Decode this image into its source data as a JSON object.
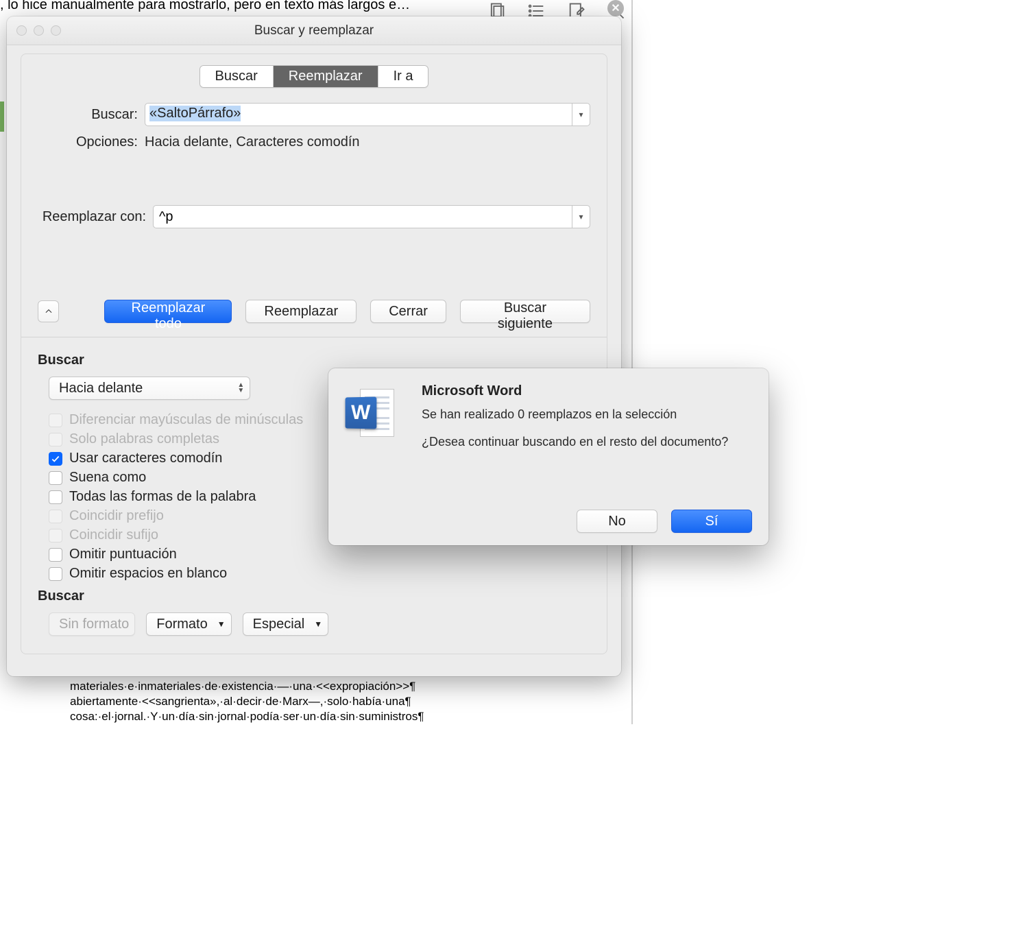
{
  "background": {
    "top_text": ", lo hice manualmente para mostrarlo, pero en texto más largos e…",
    "doc_lines": [
      "materiales·e·inmateriales·de·existencia·—·una·<<expropiación>>¶",
      "abiertamente·<<sangrienta»,·al·decir·de·Marx—,·solo·había·una¶",
      "cosa:·el·jornal.·Y·un·día·sin·jornal·podía·ser·un·día·sin·suministros¶"
    ]
  },
  "window": {
    "title": "Buscar y reemplazar",
    "tabs": {
      "search": "Buscar",
      "replace": "Reemplazar",
      "goto": "Ir a"
    },
    "labels": {
      "find": "Buscar:",
      "options": "Opciones:",
      "replace_with": "Reemplazar con:"
    },
    "find_value": "«SaltoPárrafo»",
    "options_value": "Hacia delante, Caracteres comodín",
    "replace_value": "^p",
    "buttons": {
      "replace_all": "Reemplazar todo",
      "replace": "Reemplazar",
      "close": "Cerrar",
      "find_next": "Buscar siguiente"
    },
    "section_find_title": "Buscar",
    "direction_value": "Hacia delante",
    "checks": {
      "match_case": "Diferenciar mayúsculas de minúsculas",
      "whole_words": "Solo palabras completas",
      "wildcards": "Usar caracteres comodín",
      "sounds_like": "Suena como",
      "all_forms": "Todas las formas de la palabra",
      "match_prefix": "Coincidir prefijo",
      "match_suffix": "Coincidir sufijo",
      "ignore_punct": "Omitir puntuación",
      "ignore_space": "Omitir espacios en blanco"
    },
    "section_find2_title": "Buscar",
    "format_buttons": {
      "no_format": "Sin formato",
      "format": "Formato",
      "special": "Especial"
    }
  },
  "alert": {
    "title": "Microsoft Word",
    "line1": "Se han realizado 0 reemplazos en la selección",
    "line2": "¿Desea continuar buscando en el resto del documento?",
    "no": "No",
    "yes": "Sí"
  }
}
